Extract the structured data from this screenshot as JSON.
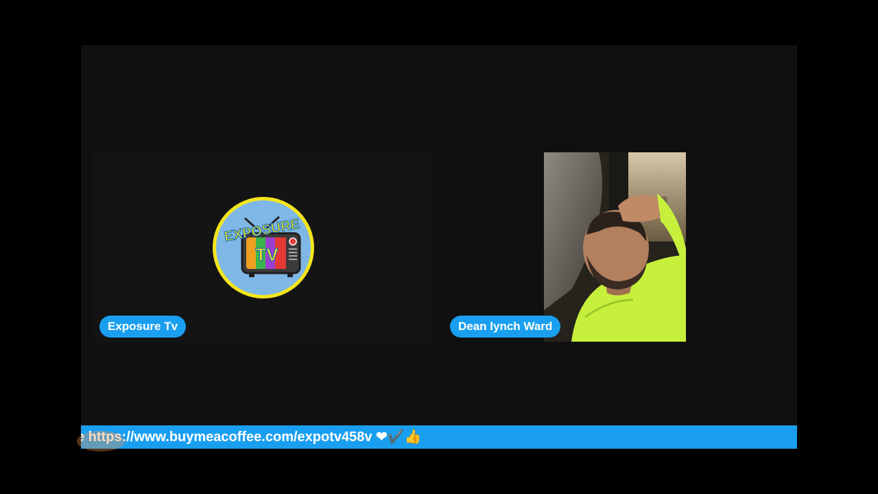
{
  "participants": [
    {
      "name": "Exposure Tv",
      "avatar_logo_text": [
        "EXPOSURE",
        "TV"
      ]
    },
    {
      "name": "Dean lynch Ward"
    }
  ],
  "ticker": {
    "text": "e https://www.buymeacoffee.com/expotv458v ❤✔️👍"
  },
  "colors": {
    "accent_blue": "#1a9ff0",
    "logo_ring": "#f5e51e",
    "stage_bg": "#101010"
  },
  "icons": [
    "exposure-tv-logo",
    "participant-video"
  ]
}
